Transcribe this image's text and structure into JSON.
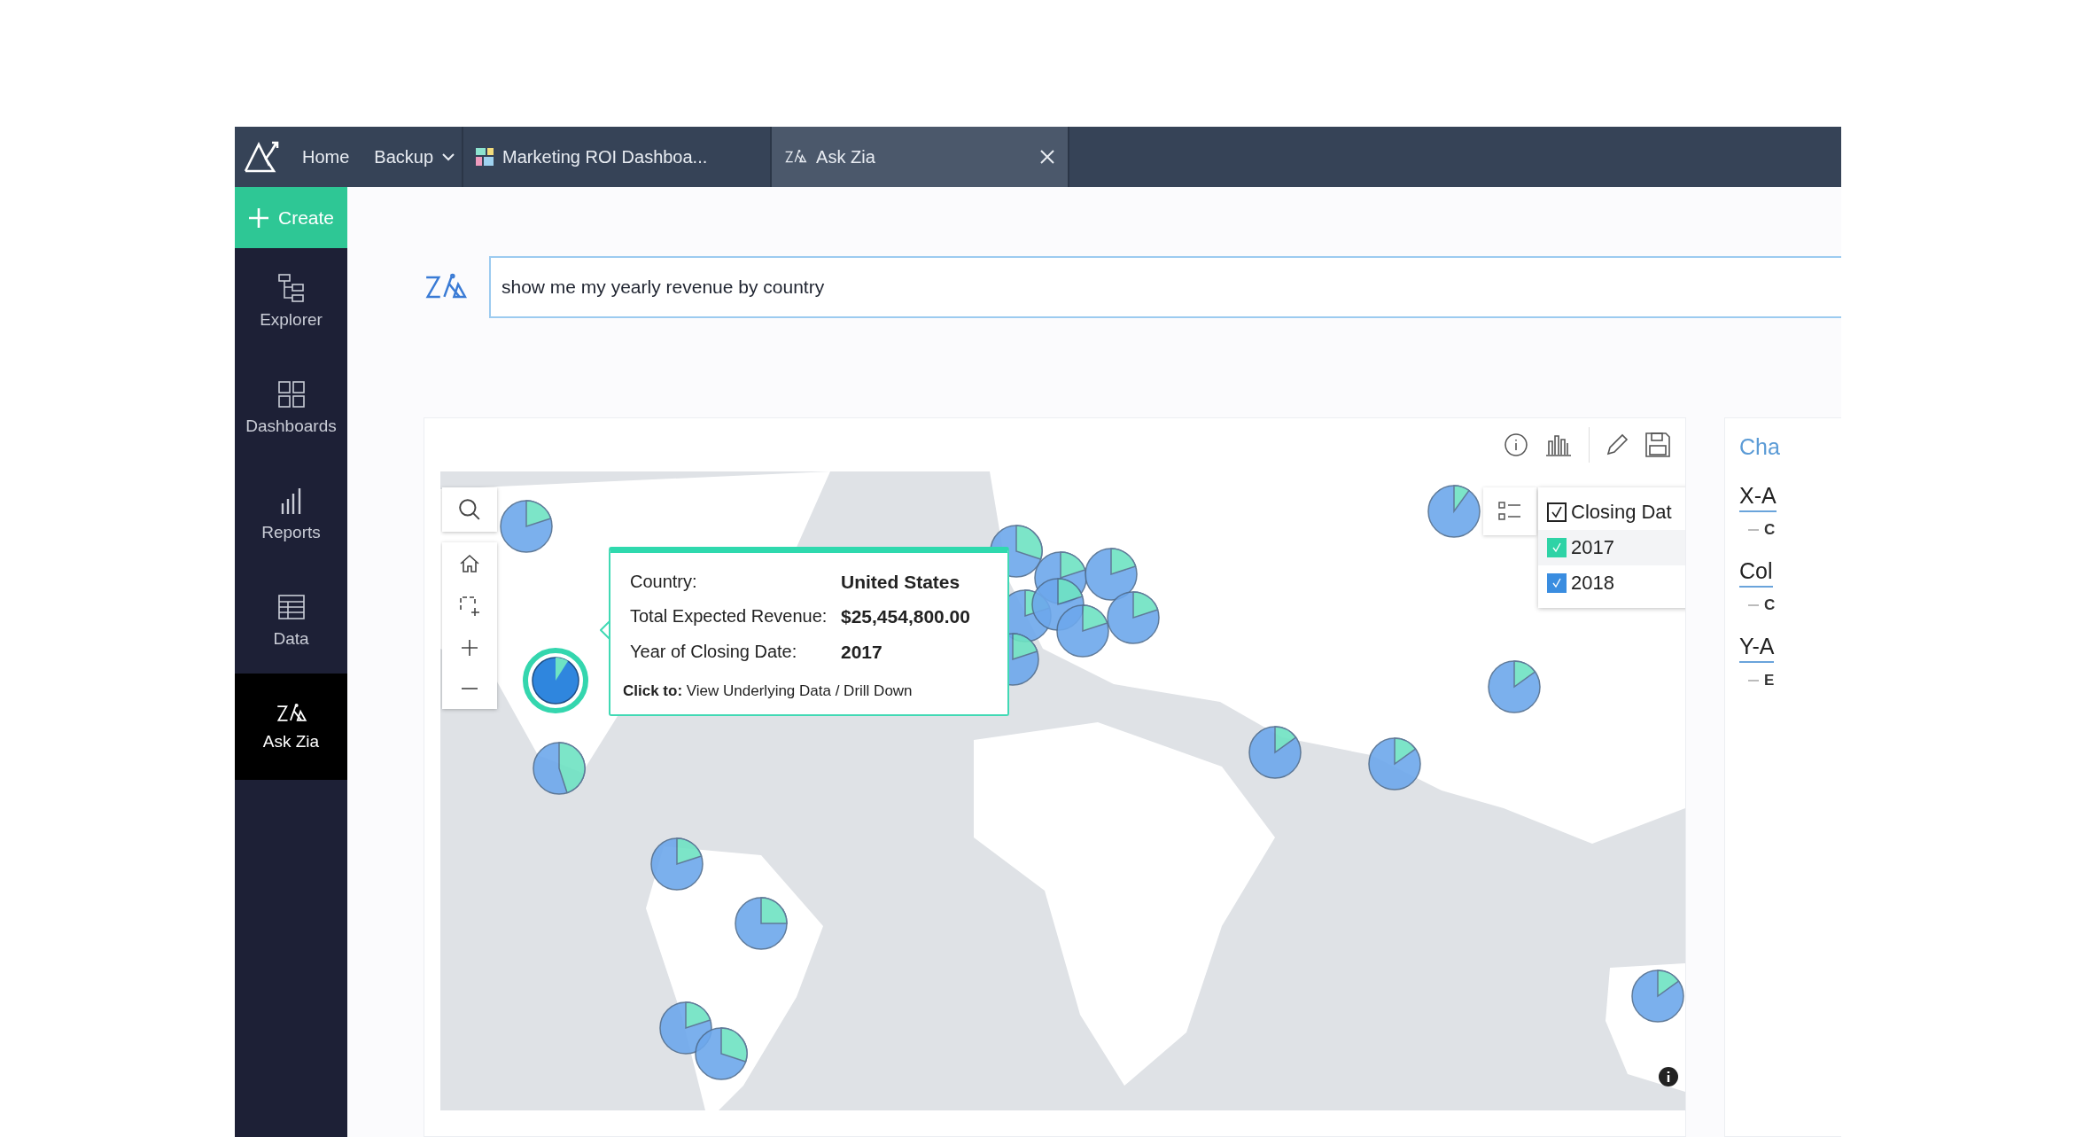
{
  "topbar": {
    "tabs": [
      {
        "label": "Home",
        "kind": "link",
        "selected": false
      },
      {
        "label": "Backup",
        "kind": "menu",
        "selected": false
      },
      {
        "label": "Marketing ROI Dashboa...",
        "kind": "dashboard",
        "selected": false
      },
      {
        "label": "Ask Zia",
        "kind": "zia",
        "selected": true
      }
    ]
  },
  "sidebar": {
    "create": "Create",
    "items": [
      {
        "label": "Explorer",
        "kind": "explorer",
        "selected": false
      },
      {
        "label": "Dashboards",
        "kind": "dashboards",
        "selected": false
      },
      {
        "label": "Reports",
        "kind": "reports",
        "selected": false
      },
      {
        "label": "Data",
        "kind": "data",
        "selected": false
      },
      {
        "label": "Ask Zia",
        "kind": "zia",
        "selected": true
      }
    ]
  },
  "query": {
    "value": "show me my yearly revenue by country"
  },
  "chart": {
    "legend": {
      "title": "Closing Dat",
      "checked": true,
      "items": [
        {
          "label": "2017",
          "color": "#2ed3a6",
          "checked": true
        },
        {
          "label": "2018",
          "color": "#3a8de0",
          "checked": true
        }
      ]
    },
    "tooltip": {
      "rows": [
        {
          "label": "Country:",
          "value": "United States"
        },
        {
          "label": "Total Expected Revenue:",
          "value": "$25,454,800.00"
        },
        {
          "label": "Year of Closing Date:",
          "value": "2017"
        }
      ],
      "footer": "**Click to:** View Underlying Data / Drill Down"
    }
  },
  "settings_panel": {
    "title": "Cha",
    "sections": [
      {
        "label": "X-A",
        "item": "C"
      },
      {
        "label": "Col",
        "item": "C"
      },
      {
        "label": "Y-A",
        "item": "E"
      }
    ]
  }
}
